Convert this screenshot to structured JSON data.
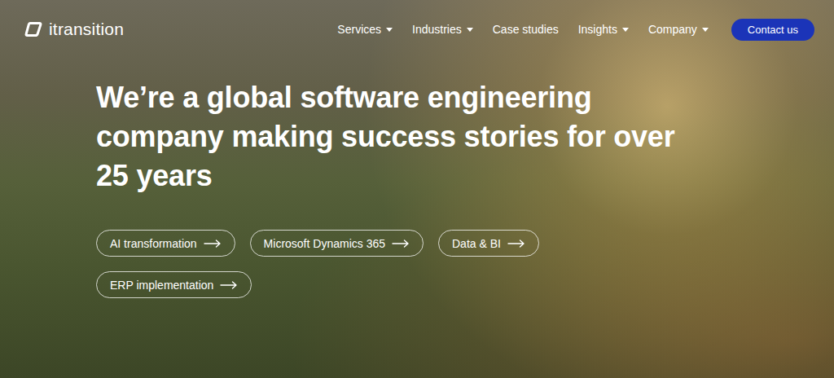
{
  "header": {
    "logo": "itransition",
    "nav": [
      {
        "label": "Services",
        "dropdown": true
      },
      {
        "label": "Industries",
        "dropdown": true
      },
      {
        "label": "Case studies",
        "dropdown": false
      },
      {
        "label": "Insights",
        "dropdown": true
      },
      {
        "label": "Company",
        "dropdown": true
      }
    ],
    "cta": "Contact us"
  },
  "hero": {
    "title": "We’re a global software engineering company making success stories for over 25 years",
    "links": [
      {
        "label": "AI transformation"
      },
      {
        "label": "Microsoft Dynamics 365"
      },
      {
        "label": "Data & BI"
      },
      {
        "label": "ERP implementation"
      }
    ]
  }
}
